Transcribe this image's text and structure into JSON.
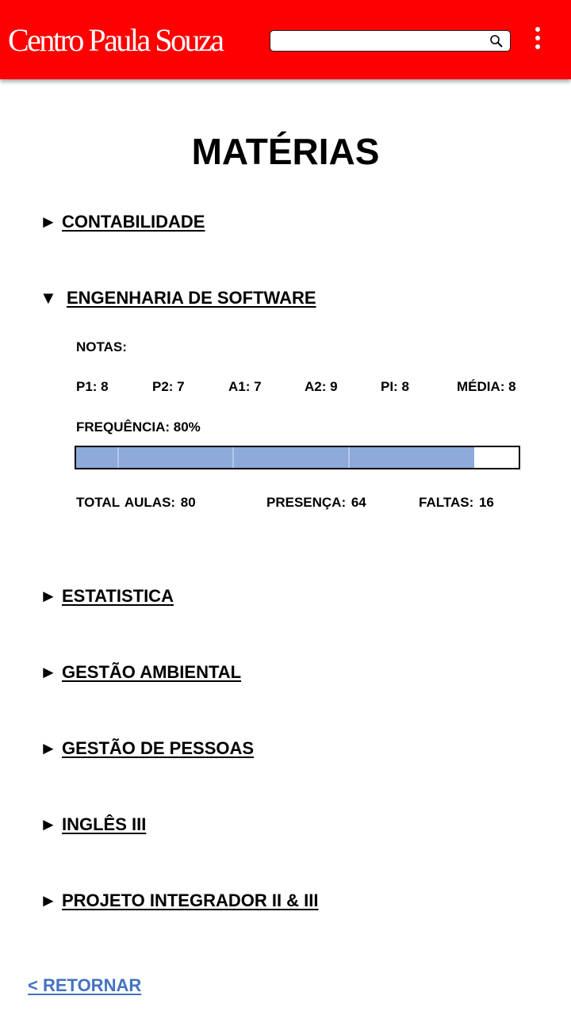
{
  "header": {
    "brand": "Centro Paula Souza",
    "search": {
      "value": "",
      "placeholder": ""
    },
    "icons": {
      "search": "search-icon",
      "menu": "more-vertical-icon"
    },
    "colors": {
      "bar": "#ff0000"
    }
  },
  "page_title": "MATÉRIAS",
  "subjects": [
    {
      "label": "CONTABILIDADE",
      "expanded": false,
      "arrow": "►"
    },
    {
      "label": "ENGENHARIA DE SOFTWARE",
      "expanded": true,
      "arrow": "▼"
    },
    {
      "label": "ESTATISTICA",
      "expanded": false,
      "arrow": "►"
    },
    {
      "label": "GESTÃO AMBIENTAL",
      "expanded": false,
      "arrow": "►"
    },
    {
      "label": "GESTÃO DE PESSOAS",
      "expanded": false,
      "arrow": "►"
    },
    {
      "label": "INGLÊS III",
      "expanded": false,
      "arrow": "►"
    },
    {
      "label": "PROJETO INTEGRADOR II & III",
      "expanded": false,
      "arrow": "►"
    }
  ],
  "details": {
    "notas_label": "NOTAS:",
    "grades": [
      "P1: 8",
      "P2: 7",
      "A1: 7",
      "A2: 9",
      "PI: 8",
      "MÉDIA: 8"
    ],
    "frequencia_label": "FREQUÊNCIA: 80%",
    "frequencia_value": 0.9,
    "fill_color": "#8eaadb",
    "total_aulas": "TOTAL AULAS: 80",
    "presenca": "PRESENÇA: 64",
    "faltas": "FALTAS: 16"
  },
  "retornar": "< RETORNAR",
  "link_color": "#4472c4"
}
